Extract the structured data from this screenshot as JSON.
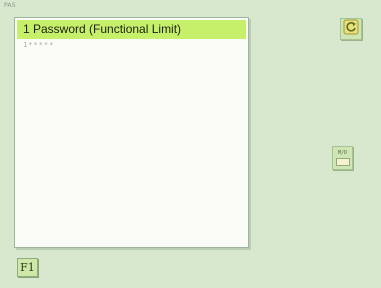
{
  "screen_label": "PAS",
  "panel": {
    "title": "1 Password (Functional Limit)",
    "password_value": "1*****"
  },
  "buttons": {
    "refresh_icon": "refresh-icon",
    "memory_icon": "memory-card-icon",
    "memory_label": "M/D",
    "f1_label": "F1"
  },
  "colors": {
    "background": "#d7e8cf",
    "title_bar": "#c7f06a",
    "panel": "#fbfcf8"
  }
}
